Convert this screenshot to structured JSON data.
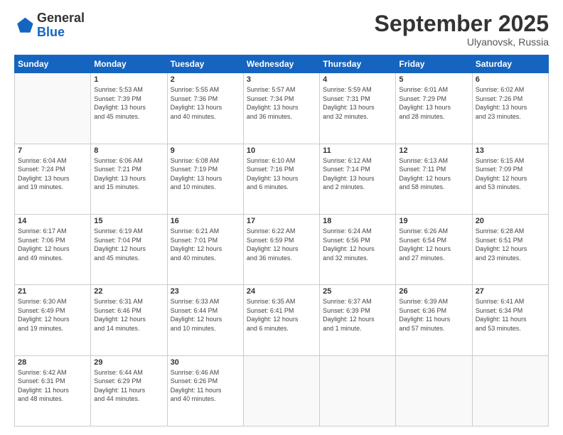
{
  "logo": {
    "general": "General",
    "blue": "Blue"
  },
  "header": {
    "month": "September 2025",
    "location": "Ulyanovsk, Russia"
  },
  "weekdays": [
    "Sunday",
    "Monday",
    "Tuesday",
    "Wednesday",
    "Thursday",
    "Friday",
    "Saturday"
  ],
  "weeks": [
    [
      {
        "day": "",
        "info": ""
      },
      {
        "day": "1",
        "info": "Sunrise: 5:53 AM\nSunset: 7:39 PM\nDaylight: 13 hours\nand 45 minutes."
      },
      {
        "day": "2",
        "info": "Sunrise: 5:55 AM\nSunset: 7:36 PM\nDaylight: 13 hours\nand 40 minutes."
      },
      {
        "day": "3",
        "info": "Sunrise: 5:57 AM\nSunset: 7:34 PM\nDaylight: 13 hours\nand 36 minutes."
      },
      {
        "day": "4",
        "info": "Sunrise: 5:59 AM\nSunset: 7:31 PM\nDaylight: 13 hours\nand 32 minutes."
      },
      {
        "day": "5",
        "info": "Sunrise: 6:01 AM\nSunset: 7:29 PM\nDaylight: 13 hours\nand 28 minutes."
      },
      {
        "day": "6",
        "info": "Sunrise: 6:02 AM\nSunset: 7:26 PM\nDaylight: 13 hours\nand 23 minutes."
      }
    ],
    [
      {
        "day": "7",
        "info": "Sunrise: 6:04 AM\nSunset: 7:24 PM\nDaylight: 13 hours\nand 19 minutes."
      },
      {
        "day": "8",
        "info": "Sunrise: 6:06 AM\nSunset: 7:21 PM\nDaylight: 13 hours\nand 15 minutes."
      },
      {
        "day": "9",
        "info": "Sunrise: 6:08 AM\nSunset: 7:19 PM\nDaylight: 13 hours\nand 10 minutes."
      },
      {
        "day": "10",
        "info": "Sunrise: 6:10 AM\nSunset: 7:16 PM\nDaylight: 13 hours\nand 6 minutes."
      },
      {
        "day": "11",
        "info": "Sunrise: 6:12 AM\nSunset: 7:14 PM\nDaylight: 13 hours\nand 2 minutes."
      },
      {
        "day": "12",
        "info": "Sunrise: 6:13 AM\nSunset: 7:11 PM\nDaylight: 12 hours\nand 58 minutes."
      },
      {
        "day": "13",
        "info": "Sunrise: 6:15 AM\nSunset: 7:09 PM\nDaylight: 12 hours\nand 53 minutes."
      }
    ],
    [
      {
        "day": "14",
        "info": "Sunrise: 6:17 AM\nSunset: 7:06 PM\nDaylight: 12 hours\nand 49 minutes."
      },
      {
        "day": "15",
        "info": "Sunrise: 6:19 AM\nSunset: 7:04 PM\nDaylight: 12 hours\nand 45 minutes."
      },
      {
        "day": "16",
        "info": "Sunrise: 6:21 AM\nSunset: 7:01 PM\nDaylight: 12 hours\nand 40 minutes."
      },
      {
        "day": "17",
        "info": "Sunrise: 6:22 AM\nSunset: 6:59 PM\nDaylight: 12 hours\nand 36 minutes."
      },
      {
        "day": "18",
        "info": "Sunrise: 6:24 AM\nSunset: 6:56 PM\nDaylight: 12 hours\nand 32 minutes."
      },
      {
        "day": "19",
        "info": "Sunrise: 6:26 AM\nSunset: 6:54 PM\nDaylight: 12 hours\nand 27 minutes."
      },
      {
        "day": "20",
        "info": "Sunrise: 6:28 AM\nSunset: 6:51 PM\nDaylight: 12 hours\nand 23 minutes."
      }
    ],
    [
      {
        "day": "21",
        "info": "Sunrise: 6:30 AM\nSunset: 6:49 PM\nDaylight: 12 hours\nand 19 minutes."
      },
      {
        "day": "22",
        "info": "Sunrise: 6:31 AM\nSunset: 6:46 PM\nDaylight: 12 hours\nand 14 minutes."
      },
      {
        "day": "23",
        "info": "Sunrise: 6:33 AM\nSunset: 6:44 PM\nDaylight: 12 hours\nand 10 minutes."
      },
      {
        "day": "24",
        "info": "Sunrise: 6:35 AM\nSunset: 6:41 PM\nDaylight: 12 hours\nand 6 minutes."
      },
      {
        "day": "25",
        "info": "Sunrise: 6:37 AM\nSunset: 6:39 PM\nDaylight: 12 hours\nand 1 minute."
      },
      {
        "day": "26",
        "info": "Sunrise: 6:39 AM\nSunset: 6:36 PM\nDaylight: 11 hours\nand 57 minutes."
      },
      {
        "day": "27",
        "info": "Sunrise: 6:41 AM\nSunset: 6:34 PM\nDaylight: 11 hours\nand 53 minutes."
      }
    ],
    [
      {
        "day": "28",
        "info": "Sunrise: 6:42 AM\nSunset: 6:31 PM\nDaylight: 11 hours\nand 48 minutes."
      },
      {
        "day": "29",
        "info": "Sunrise: 6:44 AM\nSunset: 6:29 PM\nDaylight: 11 hours\nand 44 minutes."
      },
      {
        "day": "30",
        "info": "Sunrise: 6:46 AM\nSunset: 6:26 PM\nDaylight: 11 hours\nand 40 minutes."
      },
      {
        "day": "",
        "info": ""
      },
      {
        "day": "",
        "info": ""
      },
      {
        "day": "",
        "info": ""
      },
      {
        "day": "",
        "info": ""
      }
    ]
  ]
}
